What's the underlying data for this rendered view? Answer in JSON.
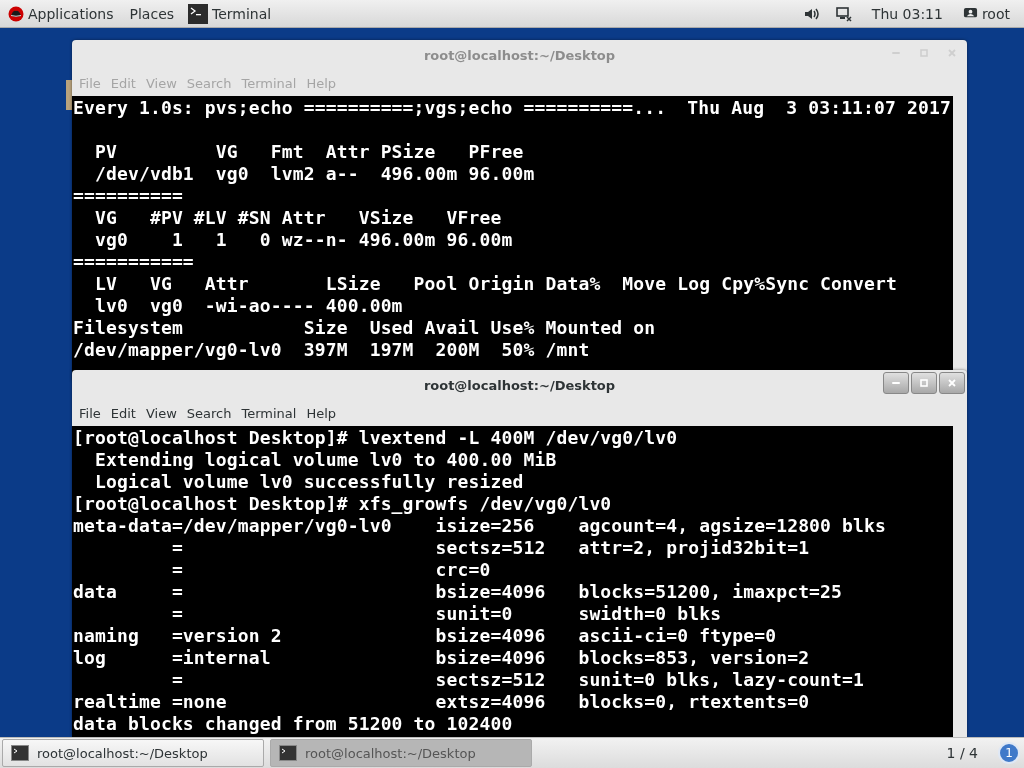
{
  "top_bar": {
    "menus": [
      {
        "label": "Applications",
        "kind": "logo"
      },
      {
        "label": "Places",
        "kind": "plain"
      },
      {
        "label": "Terminal",
        "kind": "app"
      }
    ],
    "clock": "Thu 03:11",
    "user": "root"
  },
  "windows": [
    {
      "title": "root@localhost:~/Desktop",
      "active": false,
      "menu": [
        "File",
        "Edit",
        "View",
        "Search",
        "Terminal",
        "Help"
      ],
      "watch_header": {
        "command": "Every 1.0s: pvs;echo ==========;vgs;echo ==========...",
        "time": "Thu Aug  3 03:11:07 2017"
      },
      "lines": [
        "  PV         VG   Fmt  Attr PSize   PFree",
        "  /dev/vdb1  vg0  lvm2 a--  496.00m 96.00m",
        "==========",
        "  VG   #PV #LV #SN Attr   VSize   VFree",
        "  vg0    1   1   0 wz--n- 496.00m 96.00m",
        "===========",
        "  LV   VG   Attr       LSize   Pool Origin Data%  Move Log Cpy%Sync Convert",
        "  lv0  vg0  -wi-ao---- 400.00m",
        "Filesystem           Size  Used Avail Use% Mounted on",
        "/dev/mapper/vg0-lv0  397M  197M  200M  50% /mnt"
      ]
    },
    {
      "title": "root@localhost:~/Desktop",
      "active": true,
      "menu": [
        "File",
        "Edit",
        "View",
        "Search",
        "Terminal",
        "Help"
      ],
      "lines": [
        "[root@localhost Desktop]# lvextend -L 400M /dev/vg0/lv0",
        "  Extending logical volume lv0 to 400.00 MiB",
        "  Logical volume lv0 successfully resized",
        "[root@localhost Desktop]# xfs_growfs /dev/vg0/lv0",
        "meta-data=/dev/mapper/vg0-lv0    isize=256    agcount=4, agsize=12800 blks",
        "         =                       sectsz=512   attr=2, projid32bit=1",
        "         =                       crc=0",
        "data     =                       bsize=4096   blocks=51200, imaxpct=25",
        "         =                       sunit=0      swidth=0 blks",
        "naming   =version 2              bsize=4096   ascii-ci=0 ftype=0",
        "log      =internal               bsize=4096   blocks=853, version=2",
        "         =                       sectsz=512   sunit=0 blks, lazy-count=1",
        "realtime =none                   extsz=4096   blocks=0, rtextents=0",
        "data blocks changed from 51200 to 102400"
      ]
    }
  ],
  "taskbar": {
    "tasks": [
      {
        "label": "root@localhost:~/Desktop",
        "selected": false
      },
      {
        "label": "root@localhost:~/Desktop",
        "selected": true
      }
    ],
    "workspace": "1 / 4",
    "notifications": "1"
  }
}
